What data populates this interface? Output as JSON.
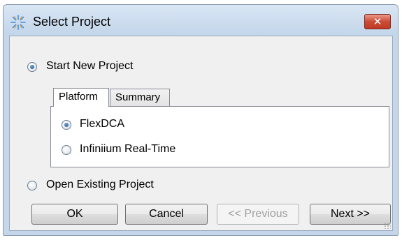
{
  "window": {
    "title": "Select Project",
    "close_label": "✕",
    "icon": "keysight-starburst-icon",
    "accent": "#c03a22"
  },
  "options": {
    "start_new": {
      "label": "Start New Project",
      "selected": true
    },
    "open_existing": {
      "label": "Open Existing Project",
      "selected": false
    }
  },
  "tabs": [
    {
      "label": "Platform",
      "active": true
    },
    {
      "label": "Summary",
      "active": false
    }
  ],
  "platforms": [
    {
      "label": "FlexDCA",
      "selected": true
    },
    {
      "label": "Infiniium Real-Time",
      "selected": false
    }
  ],
  "buttons": {
    "ok": "OK",
    "cancel": "Cancel",
    "previous": "<< Previous",
    "next": "Next >>"
  }
}
